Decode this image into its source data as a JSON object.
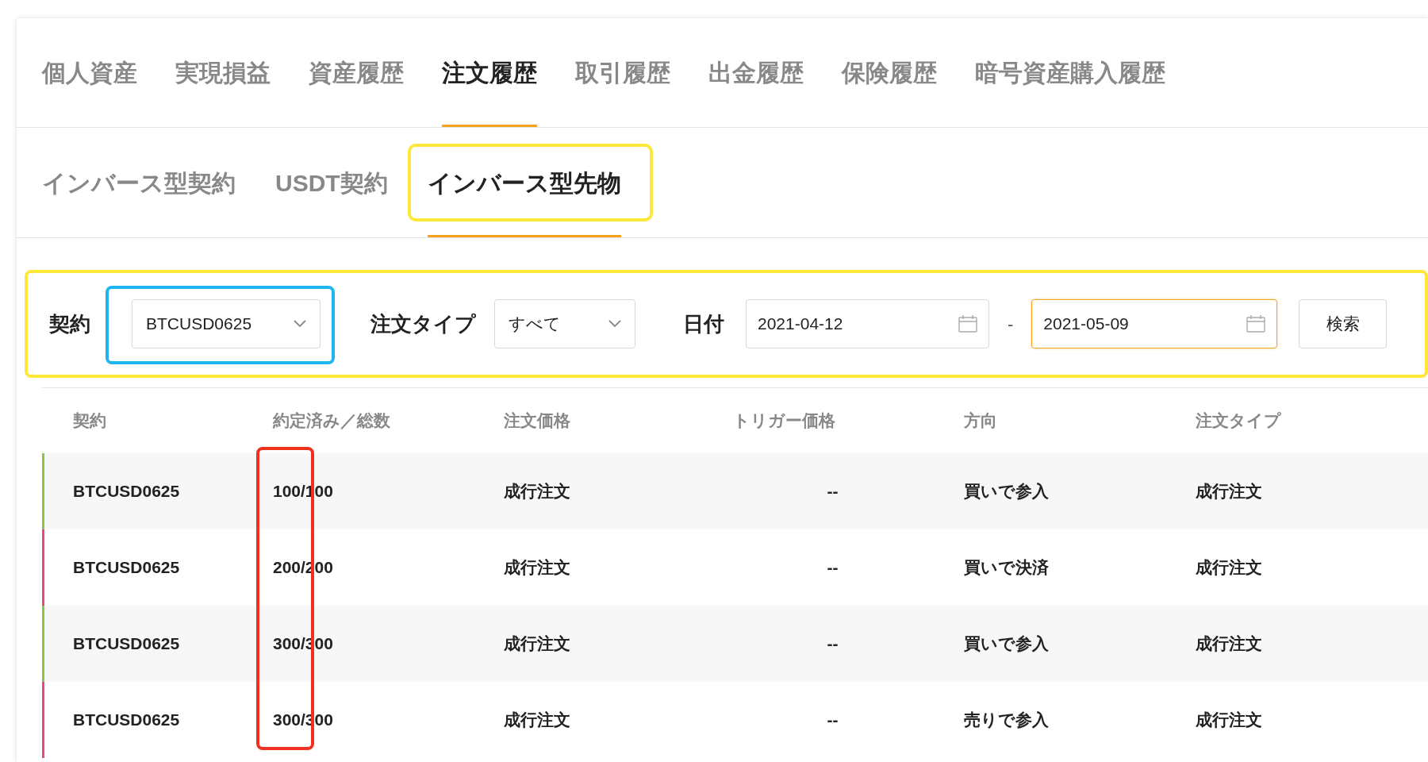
{
  "main_tabs": [
    {
      "label": "個人資産",
      "selected": false
    },
    {
      "label": "実現損益",
      "selected": false
    },
    {
      "label": "資産履歴",
      "selected": false
    },
    {
      "label": "注文履歴",
      "selected": true
    },
    {
      "label": "取引履歴",
      "selected": false
    },
    {
      "label": "出金履歴",
      "selected": false
    },
    {
      "label": "保険履歴",
      "selected": false
    },
    {
      "label": "暗号資産購入履歴",
      "selected": false
    }
  ],
  "sub_tabs": [
    {
      "label": "インバース型契約",
      "selected": false
    },
    {
      "label": "USDT契約",
      "selected": false
    },
    {
      "label": "インバース型先物",
      "selected": true
    }
  ],
  "filters": {
    "contract": {
      "label": "契約",
      "value": "BTCUSD0625"
    },
    "order_type": {
      "label": "注文タイプ",
      "value": "すべて"
    },
    "date": {
      "label": "日付",
      "from": "2021-04-12",
      "separator": "-",
      "to": "2021-05-09"
    },
    "search_button": "検索"
  },
  "table": {
    "columns": [
      "契約",
      "約定済み／総数",
      "注文価格",
      "トリガー価格",
      "方向",
      "注文タイプ"
    ],
    "rows": [
      {
        "color": "#8cc63f",
        "cells": [
          "BTCUSD0625",
          "100/100",
          "成行注文",
          "--",
          "買いで参入",
          "成行注文"
        ]
      },
      {
        "color": "#f0447c",
        "cells": [
          "BTCUSD0625",
          "200/200",
          "成行注文",
          "--",
          "買いで決済",
          "成行注文"
        ]
      },
      {
        "color": "#8cc63f",
        "cells": [
          "BTCUSD0625",
          "300/300",
          "成行注文",
          "--",
          "買いで参入",
          "成行注文"
        ]
      },
      {
        "color": "#f0447c",
        "cells": [
          "BTCUSD0625",
          "300/300",
          "成行注文",
          "--",
          "売りで参入",
          "成行注文"
        ]
      }
    ]
  }
}
